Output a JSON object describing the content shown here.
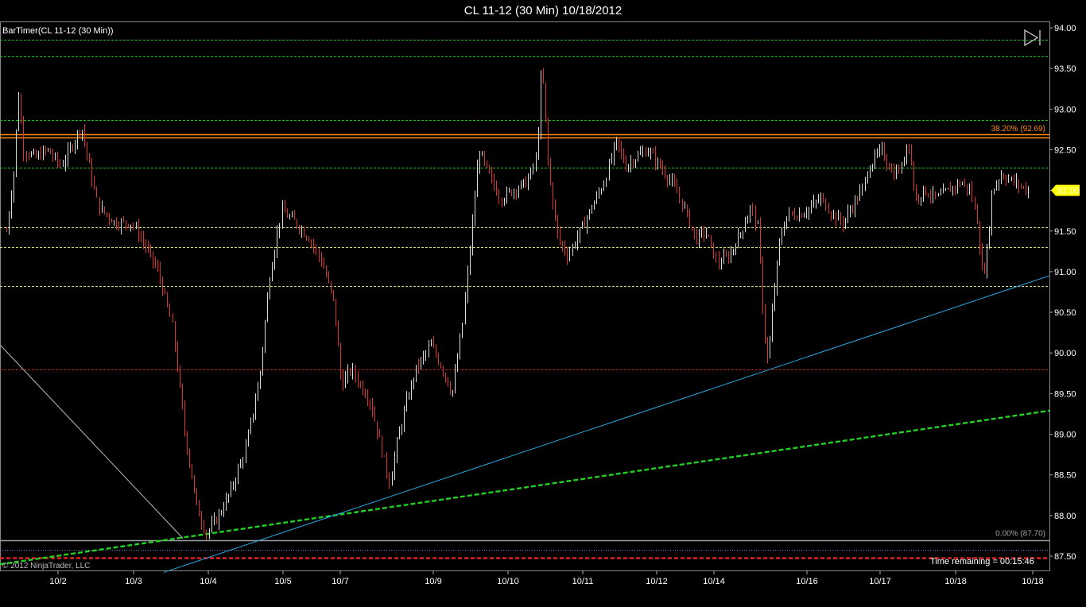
{
  "header": {
    "title": "CL 11-12 (30 Min)  10/18/2012"
  },
  "indicator_label": "BarTimer(CL 11-12 (30 Min))",
  "copyright": "© 2012 NinjaTrader, LLC",
  "time_remaining": "Time remaining = 00:15:46",
  "fib_levels": [
    {
      "label": "38.20% (92.69)",
      "value": 92.69,
      "color": "#ff8c1a"
    },
    {
      "label": "0.00% (87.70)",
      "value": 87.7,
      "color": "#9aa0a6"
    }
  ],
  "current_price": {
    "label": "92.00",
    "value": 92.0,
    "color": "#ffff00"
  },
  "icons": {
    "play_end": "play-to-end-icon"
  },
  "chart_data": {
    "type": "candlestick",
    "instrument": "CL 11-12",
    "interval": "30 Min",
    "ylim": [
      87.4,
      94.05
    ],
    "y_ticks": [
      "87.50",
      "88.00",
      "88.50",
      "89.00",
      "89.50",
      "90.00",
      "90.50",
      "91.00",
      "91.50",
      "92.00",
      "92.50",
      "93.00",
      "93.50",
      "94.00"
    ],
    "x_ticks": [
      "10/2",
      "10/3",
      "10/4",
      "10/5",
      "10/7",
      "10/9",
      "10/10",
      "10/11",
      "10/12",
      "10/14",
      "10/16",
      "10/17",
      "10/18",
      "10/18"
    ],
    "bar_count": 420,
    "path_points": [
      [
        0,
        91.5
      ],
      [
        6,
        92.2
      ],
      [
        10,
        93.2
      ],
      [
        14,
        92.5
      ],
      [
        24,
        92.4
      ],
      [
        34,
        92.5
      ],
      [
        45,
        92.3
      ],
      [
        56,
        92.6
      ],
      [
        62,
        92.8
      ],
      [
        70,
        92.2
      ],
      [
        76,
        91.8
      ],
      [
        90,
        91.6
      ],
      [
        104,
        91.6
      ],
      [
        112,
        91.4
      ],
      [
        126,
        91.0
      ],
      [
        138,
        90.3
      ],
      [
        148,
        89.0
      ],
      [
        158,
        88.1
      ],
      [
        166,
        87.78
      ],
      [
        176,
        88.0
      ],
      [
        186,
        88.3
      ],
      [
        198,
        88.8
      ],
      [
        210,
        89.7
      ],
      [
        218,
        90.9
      ],
      [
        228,
        91.75
      ],
      [
        240,
        91.6
      ],
      [
        252,
        91.4
      ],
      [
        262,
        91.1
      ],
      [
        272,
        90.6
      ],
      [
        278,
        89.6
      ],
      [
        286,
        89.8
      ],
      [
        294,
        89.6
      ],
      [
        302,
        89.4
      ],
      [
        310,
        88.9
      ],
      [
        318,
        88.4
      ],
      [
        324,
        88.9
      ],
      [
        332,
        89.4
      ],
      [
        340,
        89.8
      ],
      [
        352,
        90.1
      ],
      [
        362,
        89.8
      ],
      [
        370,
        89.5
      ],
      [
        378,
        90.3
      ],
      [
        386,
        91.5
      ],
      [
        392,
        92.5
      ],
      [
        400,
        92.2
      ],
      [
        410,
        91.9
      ],
      [
        420,
        92.0
      ],
      [
        432,
        92.1
      ],
      [
        440,
        92.4
      ],
      [
        444,
        93.6
      ],
      [
        450,
        92.2
      ],
      [
        458,
        91.4
      ],
      [
        466,
        91.2
      ],
      [
        476,
        91.5
      ],
      [
        486,
        91.8
      ],
      [
        496,
        92.1
      ],
      [
        506,
        92.6
      ],
      [
        514,
        92.3
      ],
      [
        522,
        92.4
      ],
      [
        532,
        92.5
      ],
      [
        542,
        92.3
      ],
      [
        552,
        92.1
      ],
      [
        562,
        91.8
      ],
      [
        572,
        91.4
      ],
      [
        580,
        91.5
      ],
      [
        590,
        91.1
      ],
      [
        600,
        91.2
      ],
      [
        610,
        91.5
      ],
      [
        618,
        91.8
      ],
      [
        624,
        91.5
      ],
      [
        628,
        90.4
      ],
      [
        632,
        89.85
      ],
      [
        636,
        90.6
      ],
      [
        642,
        91.4
      ],
      [
        648,
        91.7
      ],
      [
        658,
        91.7
      ],
      [
        668,
        91.8
      ],
      [
        676,
        91.9
      ],
      [
        686,
        91.7
      ],
      [
        694,
        91.6
      ],
      [
        702,
        91.8
      ],
      [
        710,
        92.0
      ],
      [
        716,
        92.3
      ],
      [
        726,
        92.5
      ],
      [
        736,
        92.2
      ],
      [
        744,
        92.3
      ],
      [
        748,
        92.7
      ],
      [
        754,
        91.9
      ],
      [
        762,
        92.0
      ],
      [
        772,
        91.9
      ],
      [
        782,
        92.0
      ],
      [
        792,
        92.1
      ],
      [
        800,
        92.0
      ],
      [
        806,
        91.6
      ],
      [
        810,
        90.9
      ],
      [
        814,
        91.3
      ],
      [
        818,
        92.0
      ],
      [
        826,
        92.2
      ],
      [
        836,
        92.1
      ],
      [
        848,
        92.0
      ]
    ],
    "horizontal_lines": [
      {
        "value": 93.85,
        "color": "#19c819",
        "style": "dashed"
      },
      {
        "value": 93.65,
        "color": "#19c819",
        "style": "dashed"
      },
      {
        "value": 92.87,
        "color": "#19c819",
        "style": "dashed"
      },
      {
        "value": 92.69,
        "color": "#ff8c1a",
        "style": "solid"
      },
      {
        "value": 92.65,
        "color": "#ff8c1a",
        "style": "solid"
      },
      {
        "value": 92.28,
        "color": "#19c819",
        "style": "dashed"
      },
      {
        "value": 91.55,
        "color": "#d8d870",
        "style": "dashed"
      },
      {
        "value": 91.3,
        "color": "#d8d870",
        "style": "dashed"
      },
      {
        "value": 90.82,
        "color": "#d8d870",
        "style": "dashed"
      },
      {
        "value": 89.8,
        "color": "#c81e1e",
        "style": "dashed"
      },
      {
        "value": 87.7,
        "color": "#9aa0a6",
        "style": "solid"
      },
      {
        "value": 87.58,
        "color": "#5a8cc8",
        "style": "dotted"
      },
      {
        "value": 87.48,
        "color": "#e02020",
        "style": "dashed"
      }
    ],
    "trendlines": [
      {
        "from": [
          0,
          87.4
        ],
        "to": [
          1320,
          89.29
        ],
        "color": "#22d022",
        "style": "dashed",
        "units": "x-pixel-in-plot"
      },
      {
        "from": [
          206,
          87.3
        ],
        "to": [
          1320,
          90.95
        ],
        "color": "#29a8e0",
        "style": "solid",
        "units": "x-pixel-in-plot"
      },
      {
        "from": [
          0,
          90.1
        ],
        "to": [
          230,
          87.72
        ],
        "color": "#bbbbbb",
        "style": "solid",
        "units": "x-pixel-in-plot"
      }
    ]
  }
}
